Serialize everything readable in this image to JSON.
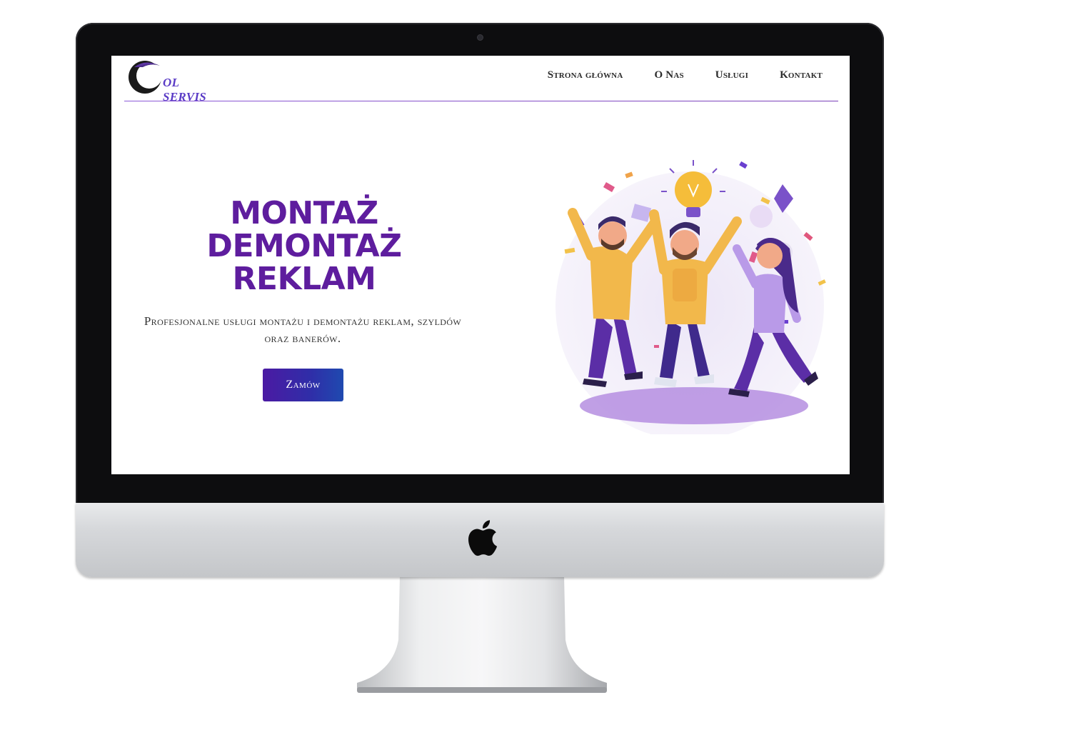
{
  "device": {
    "type": "iMac",
    "icons": {
      "brand": "apple-icon",
      "camera": "camera-icon"
    }
  },
  "site": {
    "logo": {
      "text": "OL SERVIS",
      "icon": "crescent-logo-icon"
    },
    "nav": [
      {
        "label": "Strona główna"
      },
      {
        "label": "O Nas"
      },
      {
        "label": "Usługi"
      },
      {
        "label": "Kontakt"
      }
    ],
    "hero": {
      "title_lines": [
        "MONTAŻ",
        "DEMONTAŻ",
        "REKLAM"
      ],
      "subtitle": "Profesjonalne usługi montażu i demontażu reklam, szyldów oraz banerów.",
      "button_label": "Zamów"
    },
    "illustration": {
      "icon": "celebrating-team-illustration"
    }
  },
  "colors": {
    "brand_purple": "#5e1d9e",
    "button_gradient_start": "#4b1aa3",
    "button_gradient_end": "#1f4ab0",
    "nav_text": "#2b2b2b",
    "divider": "#8d5bd8"
  }
}
